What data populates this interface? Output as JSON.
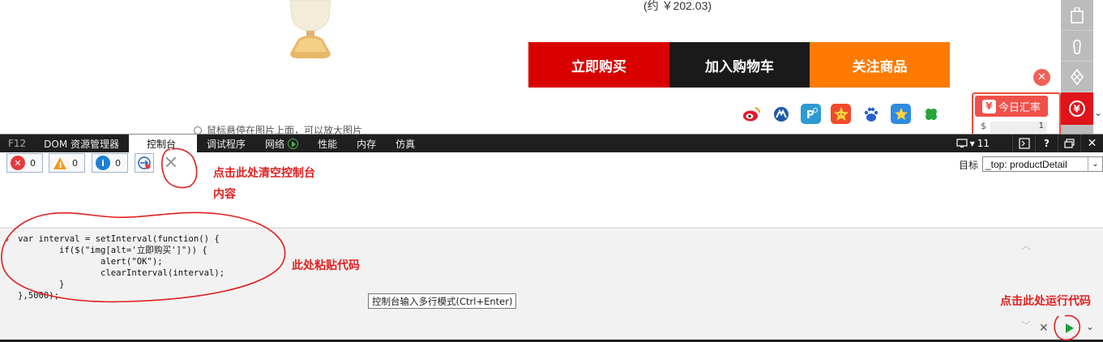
{
  "product": {
    "price_approx": "(约 ￥202.03)",
    "buy_now": "立即购买",
    "add_to_cart": "加入购物车",
    "follow_product": "关注商品",
    "image_hint": "鼠标悬停在图片上面，可以放大图片",
    "share_icons": [
      "weibo-icon",
      "renren-icon",
      "qzone-icon",
      "kaixin-icon",
      "baidu-icon",
      "favorite-star-icon",
      "clover-icon"
    ],
    "rate_widget": {
      "tab_label": "今日汇率",
      "currency_symbol": "$",
      "amount": "1"
    }
  },
  "devtools": {
    "tabs": [
      {
        "label": "F12"
      },
      {
        "label": "DOM 资源管理器"
      },
      {
        "label": "控制台"
      },
      {
        "label": "调试程序"
      },
      {
        "label": "网络"
      },
      {
        "label": "性能"
      },
      {
        "label": "内存"
      },
      {
        "label": "仿真"
      }
    ],
    "active_tab": "控制台",
    "doc_mode": "11",
    "counters": {
      "errors": "0",
      "warnings": "0",
      "info": "0"
    },
    "target_label": "目标",
    "target_value": "_top: productDetail",
    "console_code": "var interval = setInterval(function() {\n        if($(\"img[alt='立即购买']\")) {\n                alert(\"OK\");\n                clearInterval(interval);\n        }\n},5000);",
    "tooltip": "控制台输入多行模式(Ctrl+Enter)"
  },
  "annotations": {
    "clear_console_line1": "点击此处清空控制台",
    "clear_console_line2": "内容",
    "paste_code": "此处粘贴代码",
    "run_code": "点击此处运行代码"
  },
  "colors": {
    "buy_now": "#d90000",
    "add_cart": "#1a1a1a",
    "follow": "#ff7a00",
    "annotation": "#e02020",
    "devtools_bar": "#1f1f1f"
  }
}
